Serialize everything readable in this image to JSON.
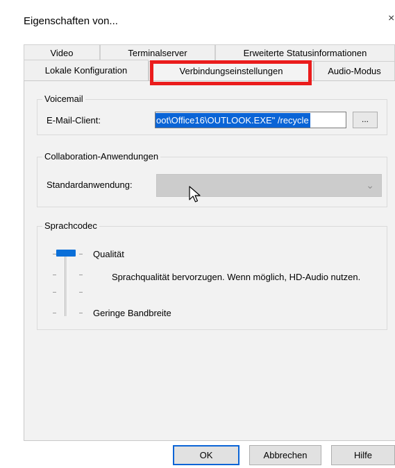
{
  "window": {
    "title": "Eigenschaften von...",
    "close": "×"
  },
  "tabs": {
    "back_row": [
      {
        "label": "Video"
      },
      {
        "label": "Terminalserver"
      },
      {
        "label": "Erweiterte Statusinformationen"
      }
    ],
    "front_row": [
      {
        "label": "Lokale Konfiguration"
      },
      {
        "label": "Verbindungseinstellungen"
      },
      {
        "label": "Audio-Modus"
      }
    ],
    "active": "Verbindungseinstellungen"
  },
  "voicemail": {
    "legend": "Voicemail",
    "email_label": "E-Mail-Client:",
    "email_value": "oot\\Office16\\OUTLOOK.EXE\" /recycle",
    "browse_label": "..."
  },
  "collab": {
    "legend": "Collaboration-Anwendungen",
    "default_label": "Standardanwendung:",
    "default_value": ""
  },
  "codec": {
    "legend": "Sprachcodec",
    "quality_label": "Qualität",
    "description": "Sprachqualität bervorzugen. Wenn möglich, HD-Audio nutzen.",
    "low_bandwidth_label": "Geringe Bandbreite",
    "slider_level": 1.0
  },
  "buttons": {
    "ok": "OK",
    "cancel": "Abbrechen",
    "help": "Hilfe"
  },
  "colors": {
    "highlight": "#ea1c1c",
    "accent": "#0a64d6"
  }
}
